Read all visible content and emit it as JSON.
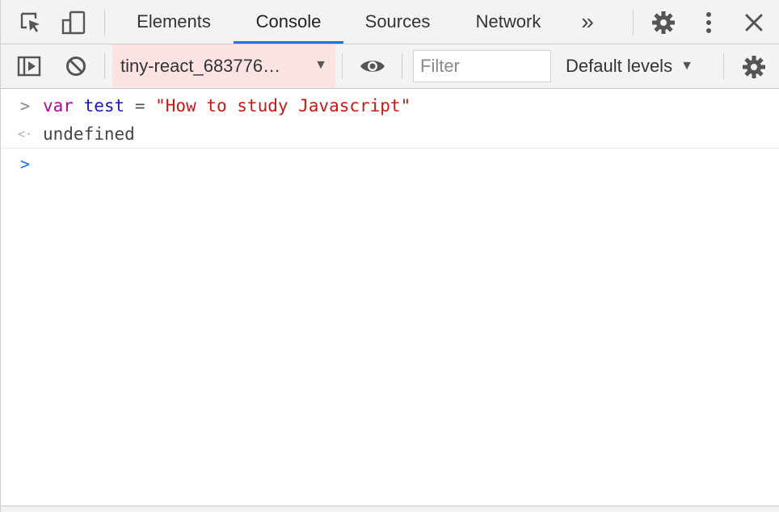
{
  "tabbar": {
    "tabs": [
      {
        "label": "Elements",
        "active": false
      },
      {
        "label": "Console",
        "active": true
      },
      {
        "label": "Sources",
        "active": false
      },
      {
        "label": "Network",
        "active": false
      }
    ],
    "more_label": "»",
    "icons": {
      "inspect": "inspect-element-icon",
      "device": "device-toolbar-icon",
      "settings": "gear-icon",
      "menu": "kebab-menu-icon",
      "close": "close-icon"
    }
  },
  "toolbar": {
    "context_label": "tiny-react_683776…",
    "context_arrow": "▼",
    "filter_placeholder": "Filter",
    "filter_value": "",
    "levels_label": "Default levels",
    "levels_arrow": "▼",
    "icons": {
      "sidebar": "show-sidebar-icon",
      "clear": "clear-console-icon",
      "live_expression": "eye-icon",
      "settings": "gear-icon"
    }
  },
  "console": {
    "entries": [
      {
        "type": "input",
        "prefix": ">",
        "tokens": {
          "keyword": "var",
          "space1": " ",
          "name": "test",
          "space2": " ",
          "operator": "=",
          "space3": " ",
          "string": "\"How to study Javascript\""
        }
      },
      {
        "type": "result",
        "prefix": "<·",
        "text": "undefined"
      }
    ],
    "prompt": ">"
  },
  "colors": {
    "accent": "#1a73e8",
    "context_bg": "#fbe3e3",
    "keyword": "#aa0d91",
    "string": "#c41a16",
    "variable": "#1c00cf"
  }
}
